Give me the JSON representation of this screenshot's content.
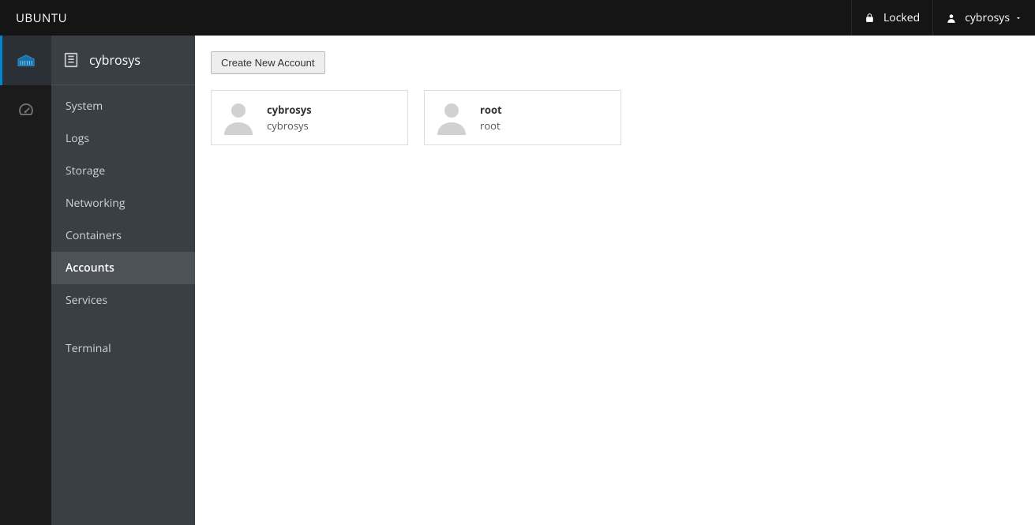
{
  "topbar": {
    "brand": "UBUNTU",
    "locked_label": "Locked",
    "user_label": "cybrosys"
  },
  "sidebar": {
    "host_title": "cybrosys",
    "items": [
      {
        "label": "System",
        "active": false
      },
      {
        "label": "Logs",
        "active": false
      },
      {
        "label": "Storage",
        "active": false
      },
      {
        "label": "Networking",
        "active": false
      },
      {
        "label": "Containers",
        "active": false
      },
      {
        "label": "Accounts",
        "active": true
      },
      {
        "label": "Services",
        "active": false
      }
    ],
    "secondary_items": [
      {
        "label": "Terminal"
      }
    ]
  },
  "main": {
    "create_button_label": "Create New Account",
    "accounts": [
      {
        "display_name": "cybrosys",
        "username": "cybrosys"
      },
      {
        "display_name": "root",
        "username": "root"
      }
    ]
  }
}
